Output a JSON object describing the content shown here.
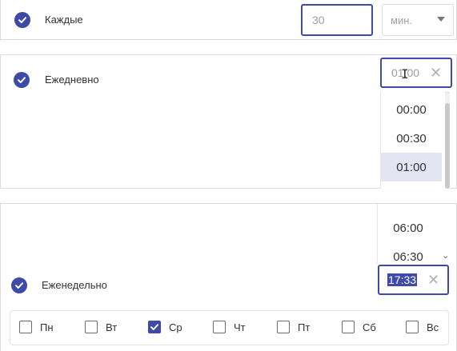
{
  "every": {
    "label": "Каждые",
    "value": "30",
    "unit": "мин."
  },
  "daily": {
    "label": "Ежедневно",
    "placeholder": "01:00",
    "options": [
      "00:00",
      "00:30",
      "01:00"
    ],
    "selected": "01:00"
  },
  "weekly": {
    "label": "Еженедельно",
    "value": "17:33",
    "options": [
      "06:00",
      "06:30"
    ],
    "days": [
      {
        "label": "Пн",
        "checked": false
      },
      {
        "label": "Вт",
        "checked": false
      },
      {
        "label": "Ср",
        "checked": true
      },
      {
        "label": "Чт",
        "checked": false
      },
      {
        "label": "Пт",
        "checked": false
      },
      {
        "label": "Сб",
        "checked": false
      },
      {
        "label": "Вс",
        "checked": false
      }
    ]
  },
  "colors": {
    "accent": "#3d4aa8",
    "selected_option_bg": "#e3e6f2"
  },
  "icons": {
    "check": "check-icon",
    "clear": "close-icon",
    "caret": "chevron-down-icon",
    "cursor": "text-cursor-icon"
  }
}
